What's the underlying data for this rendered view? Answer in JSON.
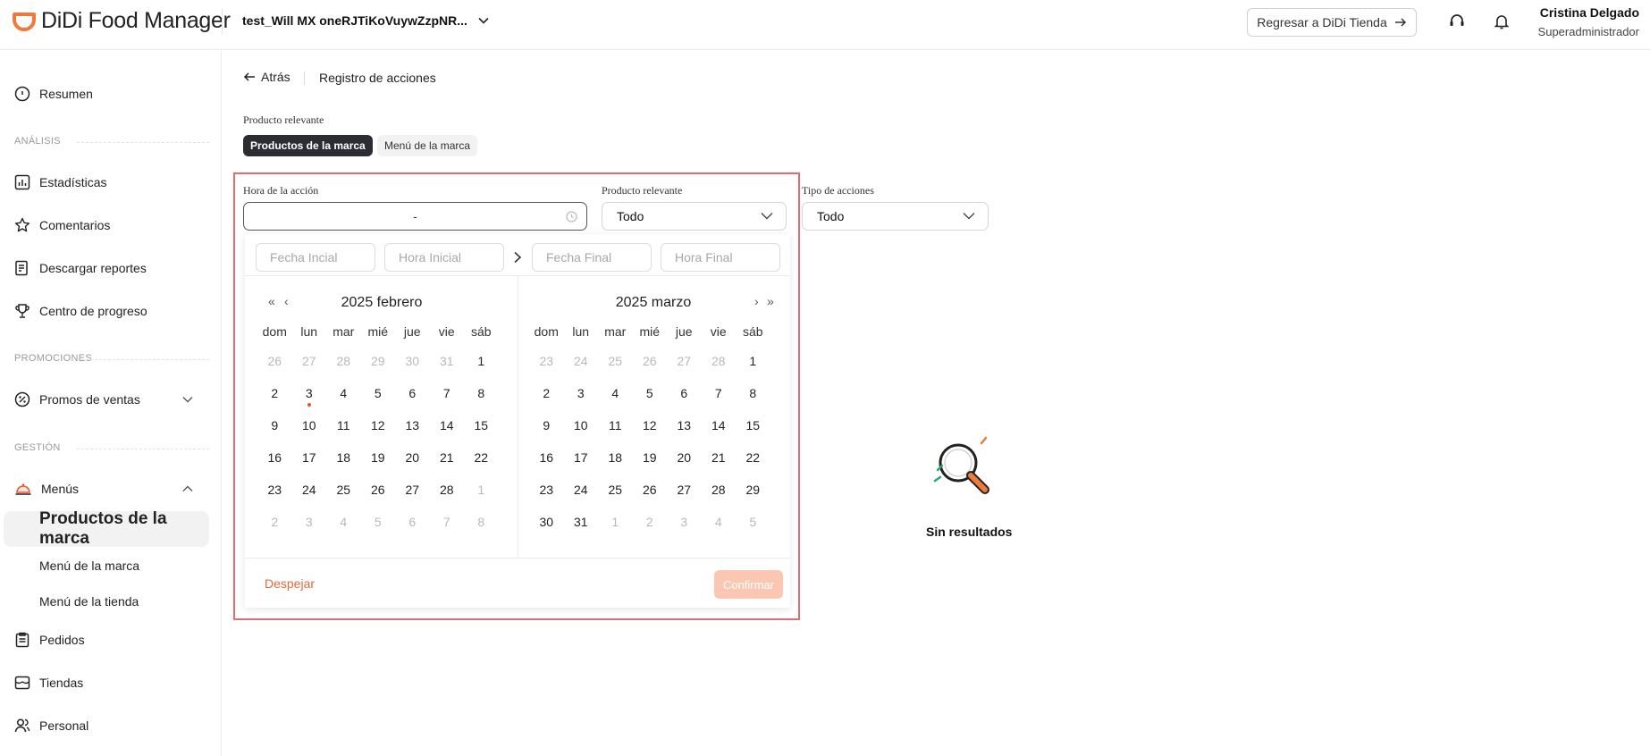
{
  "header": {
    "logo_text": "DiDi Food Manager",
    "store_name": "test_Will MX oneRJTiKoVuywZzpNR...",
    "return_button": "Regresar a DiDi Tienda",
    "user_name": "Cristina Delgado",
    "user_role": "Superadministrador"
  },
  "sidebar": {
    "resumen": "Resumen",
    "analisis": "ANÁLISIS",
    "estadisticas": "Estadísticas",
    "comentarios": "Comentarios",
    "descargar": "Descargar reportes",
    "centro": "Centro de progreso",
    "promociones": "PROMOCIONES",
    "promos": "Promos de ventas",
    "gestion": "GESTIÓN",
    "menus": "Menús",
    "productos": "Productos de la marca",
    "menu_marca": "Menú de la marca",
    "menu_tienda": "Menú de la tienda",
    "pedidos": "Pedidos",
    "tiendas": "Tiendas",
    "personal": "Personal"
  },
  "main": {
    "back": "Atrás",
    "breadcrumb": "Registro de acciones",
    "relevant_label": "Producto relevante",
    "chip_active": "Productos de la marca",
    "chip_inactive": "Menú de la marca",
    "filter_time_label": "Hora de la acción",
    "filter_time_value": "-",
    "filter_product_label": "Producto relevante",
    "filter_product_value": "Todo",
    "filter_type_label": "Tipo de acciones",
    "filter_type_value": "Todo",
    "empty": "Sin resultados"
  },
  "calendar": {
    "start_date_ph": "Fecha Incial",
    "start_time_ph": "Hora Inicial",
    "end_date_ph": "Fecha Final",
    "end_time_ph": "Hora Final",
    "left_title": "2025 febrero",
    "right_title": "2025 marzo",
    "weekdays": [
      "dom",
      "lun",
      "mar",
      "mié",
      "jue",
      "vie",
      "sáb"
    ],
    "left_days": [
      [
        "26",
        "o"
      ],
      [
        "27",
        "o"
      ],
      [
        "28",
        "o"
      ],
      [
        "29",
        "o"
      ],
      [
        "30",
        "o"
      ],
      [
        "31",
        "o"
      ],
      [
        "1",
        ""
      ],
      [
        "2",
        ""
      ],
      [
        "3",
        "t"
      ],
      [
        "4",
        ""
      ],
      [
        "5",
        ""
      ],
      [
        "6",
        ""
      ],
      [
        "7",
        ""
      ],
      [
        "8",
        ""
      ],
      [
        "9",
        ""
      ],
      [
        "10",
        ""
      ],
      [
        "11",
        ""
      ],
      [
        "12",
        ""
      ],
      [
        "13",
        ""
      ],
      [
        "14",
        ""
      ],
      [
        "15",
        ""
      ],
      [
        "16",
        ""
      ],
      [
        "17",
        ""
      ],
      [
        "18",
        ""
      ],
      [
        "19",
        ""
      ],
      [
        "20",
        ""
      ],
      [
        "21",
        ""
      ],
      [
        "22",
        ""
      ],
      [
        "23",
        ""
      ],
      [
        "24",
        ""
      ],
      [
        "25",
        ""
      ],
      [
        "26",
        ""
      ],
      [
        "27",
        ""
      ],
      [
        "28",
        ""
      ],
      [
        "1",
        "o"
      ],
      [
        "2",
        "o"
      ],
      [
        "3",
        "o"
      ],
      [
        "4",
        "o"
      ],
      [
        "5",
        "o"
      ],
      [
        "6",
        "o"
      ],
      [
        "7",
        "o"
      ],
      [
        "8",
        "o"
      ]
    ],
    "right_days": [
      [
        "23",
        "o"
      ],
      [
        "24",
        "o"
      ],
      [
        "25",
        "o"
      ],
      [
        "26",
        "o"
      ],
      [
        "27",
        "o"
      ],
      [
        "28",
        "o"
      ],
      [
        "1",
        ""
      ],
      [
        "2",
        ""
      ],
      [
        "3",
        ""
      ],
      [
        "4",
        ""
      ],
      [
        "5",
        ""
      ],
      [
        "6",
        ""
      ],
      [
        "7",
        ""
      ],
      [
        "8",
        ""
      ],
      [
        "9",
        ""
      ],
      [
        "10",
        ""
      ],
      [
        "11",
        ""
      ],
      [
        "12",
        ""
      ],
      [
        "13",
        ""
      ],
      [
        "14",
        ""
      ],
      [
        "15",
        ""
      ],
      [
        "16",
        ""
      ],
      [
        "17",
        ""
      ],
      [
        "18",
        ""
      ],
      [
        "19",
        ""
      ],
      [
        "20",
        ""
      ],
      [
        "21",
        ""
      ],
      [
        "22",
        ""
      ],
      [
        "23",
        ""
      ],
      [
        "24",
        ""
      ],
      [
        "25",
        ""
      ],
      [
        "26",
        ""
      ],
      [
        "27",
        ""
      ],
      [
        "28",
        ""
      ],
      [
        "29",
        ""
      ],
      [
        "30",
        ""
      ],
      [
        "31",
        ""
      ],
      [
        "1",
        "o"
      ],
      [
        "2",
        "o"
      ],
      [
        "3",
        "o"
      ],
      [
        "4",
        "o"
      ],
      [
        "5",
        "o"
      ]
    ],
    "clear": "Despejar",
    "confirm": "Confirmar"
  },
  "colors": {
    "accent": "#f07a3c",
    "dark": "#2b2d33",
    "highlight": "#e36b72"
  }
}
